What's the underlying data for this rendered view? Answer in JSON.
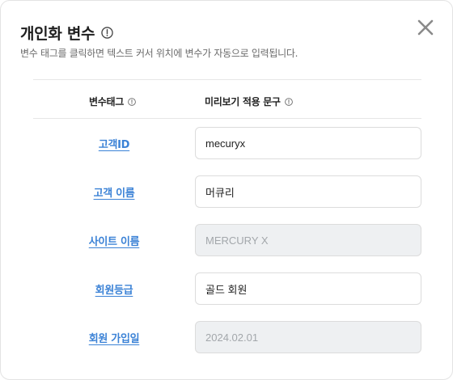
{
  "dialog": {
    "title": "개인화 변수",
    "subtitle": "변수 태그를 클릭하면 텍스트 커서 위치에 변수가 자동으로 입력됩니다."
  },
  "table": {
    "headers": {
      "tag": "변수태그",
      "preview": "미리보기 적용 문구"
    },
    "rows": [
      {
        "label": "고객ID",
        "value": "mecuryx",
        "disabled": false
      },
      {
        "label": "고객 이름",
        "value": "머큐리",
        "disabled": false
      },
      {
        "label": "사이트 이름",
        "value": "MERCURY X",
        "disabled": true
      },
      {
        "label": "회원등급",
        "value": "골드 회원",
        "disabled": false
      },
      {
        "label": "회원 가입일",
        "value": "2024.02.01",
        "disabled": true
      }
    ]
  },
  "icons": {
    "title_info": "info-icon",
    "header_info": "info-icon",
    "close": "close-icon"
  },
  "colors": {
    "link": "#3b82d6",
    "disabled_bg": "#eef0f2",
    "disabled_text": "#a3a7ab"
  }
}
